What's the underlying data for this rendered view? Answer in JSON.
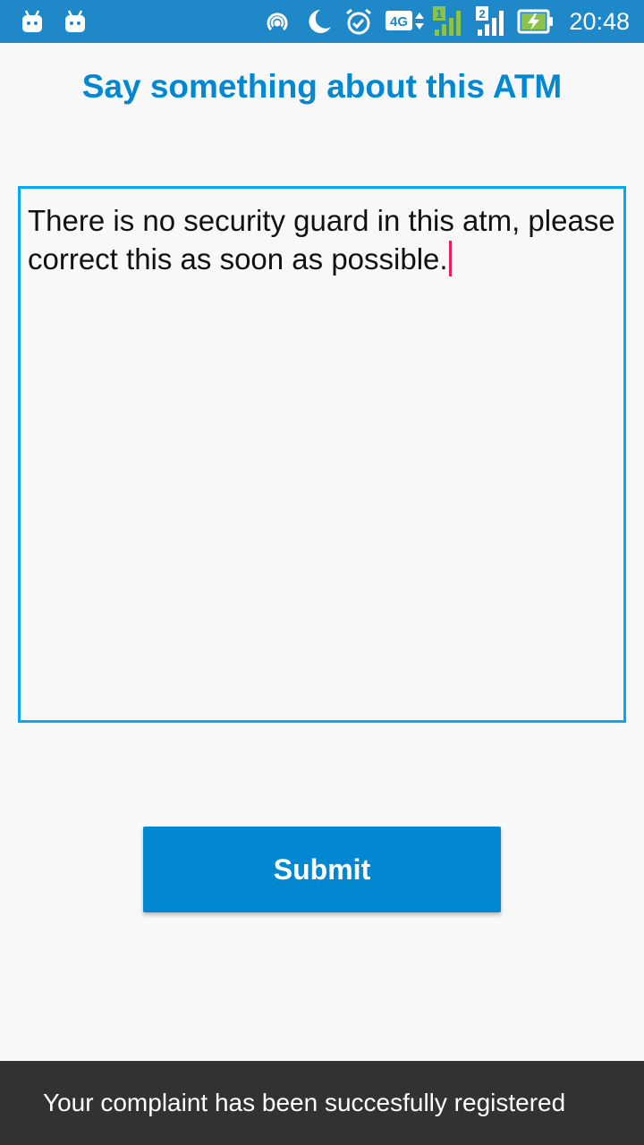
{
  "status_bar": {
    "time": "20:48",
    "network_type": "4G",
    "sim1_label": "1",
    "sim2_label": "2",
    "background_color": "#1e88c9",
    "icons": [
      "android-notification-icon",
      "android-notification-icon",
      "hotspot-icon",
      "moon-icon",
      "alarm-icon",
      "network-4g-icon",
      "signal-sim1-icon",
      "signal-sim2-icon",
      "battery-charging-icon"
    ]
  },
  "page": {
    "title": "Say something about this ATM"
  },
  "complaint": {
    "text": "There is no security guard in this atm, please correct this as soon as possible."
  },
  "form": {
    "submit_label": "Submit"
  },
  "snackbar": {
    "message": "Your complaint has been succesfully registered"
  },
  "colors": {
    "accent": "#0288d1",
    "input_border": "#03a9f4",
    "cursor": "#e91e63",
    "snackbar_bg": "#323232"
  }
}
